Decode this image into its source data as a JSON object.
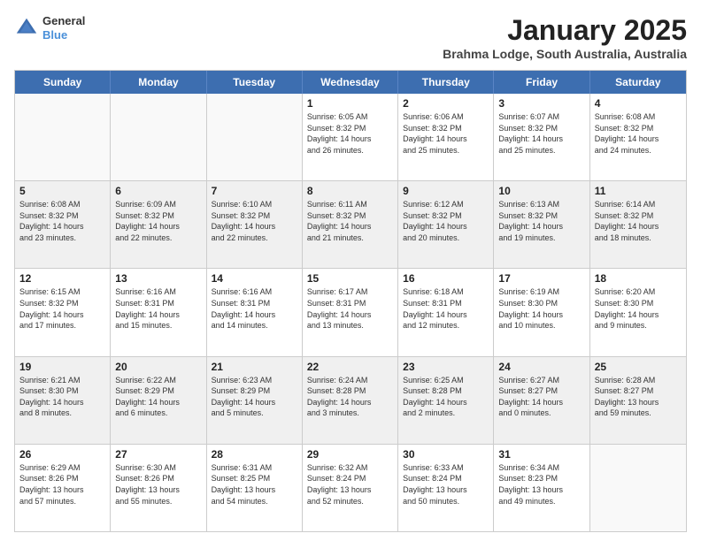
{
  "logo": {
    "line1": "General",
    "line2": "Blue"
  },
  "title": "January 2025",
  "location": "Brahma Lodge, South Australia, Australia",
  "days_of_week": [
    "Sunday",
    "Monday",
    "Tuesday",
    "Wednesday",
    "Thursday",
    "Friday",
    "Saturday"
  ],
  "weeks": [
    [
      {
        "day": "",
        "info": "",
        "empty": true
      },
      {
        "day": "",
        "info": "",
        "empty": true
      },
      {
        "day": "",
        "info": "",
        "empty": true
      },
      {
        "day": "1",
        "info": "Sunrise: 6:05 AM\nSunset: 8:32 PM\nDaylight: 14 hours\nand 26 minutes."
      },
      {
        "day": "2",
        "info": "Sunrise: 6:06 AM\nSunset: 8:32 PM\nDaylight: 14 hours\nand 25 minutes."
      },
      {
        "day": "3",
        "info": "Sunrise: 6:07 AM\nSunset: 8:32 PM\nDaylight: 14 hours\nand 25 minutes."
      },
      {
        "day": "4",
        "info": "Sunrise: 6:08 AM\nSunset: 8:32 PM\nDaylight: 14 hours\nand 24 minutes."
      }
    ],
    [
      {
        "day": "5",
        "info": "Sunrise: 6:08 AM\nSunset: 8:32 PM\nDaylight: 14 hours\nand 23 minutes."
      },
      {
        "day": "6",
        "info": "Sunrise: 6:09 AM\nSunset: 8:32 PM\nDaylight: 14 hours\nand 22 minutes."
      },
      {
        "day": "7",
        "info": "Sunrise: 6:10 AM\nSunset: 8:32 PM\nDaylight: 14 hours\nand 22 minutes."
      },
      {
        "day": "8",
        "info": "Sunrise: 6:11 AM\nSunset: 8:32 PM\nDaylight: 14 hours\nand 21 minutes."
      },
      {
        "day": "9",
        "info": "Sunrise: 6:12 AM\nSunset: 8:32 PM\nDaylight: 14 hours\nand 20 minutes."
      },
      {
        "day": "10",
        "info": "Sunrise: 6:13 AM\nSunset: 8:32 PM\nDaylight: 14 hours\nand 19 minutes."
      },
      {
        "day": "11",
        "info": "Sunrise: 6:14 AM\nSunset: 8:32 PM\nDaylight: 14 hours\nand 18 minutes."
      }
    ],
    [
      {
        "day": "12",
        "info": "Sunrise: 6:15 AM\nSunset: 8:32 PM\nDaylight: 14 hours\nand 17 minutes."
      },
      {
        "day": "13",
        "info": "Sunrise: 6:16 AM\nSunset: 8:31 PM\nDaylight: 14 hours\nand 15 minutes."
      },
      {
        "day": "14",
        "info": "Sunrise: 6:16 AM\nSunset: 8:31 PM\nDaylight: 14 hours\nand 14 minutes."
      },
      {
        "day": "15",
        "info": "Sunrise: 6:17 AM\nSunset: 8:31 PM\nDaylight: 14 hours\nand 13 minutes."
      },
      {
        "day": "16",
        "info": "Sunrise: 6:18 AM\nSunset: 8:31 PM\nDaylight: 14 hours\nand 12 minutes."
      },
      {
        "day": "17",
        "info": "Sunrise: 6:19 AM\nSunset: 8:30 PM\nDaylight: 14 hours\nand 10 minutes."
      },
      {
        "day": "18",
        "info": "Sunrise: 6:20 AM\nSunset: 8:30 PM\nDaylight: 14 hours\nand 9 minutes."
      }
    ],
    [
      {
        "day": "19",
        "info": "Sunrise: 6:21 AM\nSunset: 8:30 PM\nDaylight: 14 hours\nand 8 minutes."
      },
      {
        "day": "20",
        "info": "Sunrise: 6:22 AM\nSunset: 8:29 PM\nDaylight: 14 hours\nand 6 minutes."
      },
      {
        "day": "21",
        "info": "Sunrise: 6:23 AM\nSunset: 8:29 PM\nDaylight: 14 hours\nand 5 minutes."
      },
      {
        "day": "22",
        "info": "Sunrise: 6:24 AM\nSunset: 8:28 PM\nDaylight: 14 hours\nand 3 minutes."
      },
      {
        "day": "23",
        "info": "Sunrise: 6:25 AM\nSunset: 8:28 PM\nDaylight: 14 hours\nand 2 minutes."
      },
      {
        "day": "24",
        "info": "Sunrise: 6:27 AM\nSunset: 8:27 PM\nDaylight: 14 hours\nand 0 minutes."
      },
      {
        "day": "25",
        "info": "Sunrise: 6:28 AM\nSunset: 8:27 PM\nDaylight: 13 hours\nand 59 minutes."
      }
    ],
    [
      {
        "day": "26",
        "info": "Sunrise: 6:29 AM\nSunset: 8:26 PM\nDaylight: 13 hours\nand 57 minutes."
      },
      {
        "day": "27",
        "info": "Sunrise: 6:30 AM\nSunset: 8:26 PM\nDaylight: 13 hours\nand 55 minutes."
      },
      {
        "day": "28",
        "info": "Sunrise: 6:31 AM\nSunset: 8:25 PM\nDaylight: 13 hours\nand 54 minutes."
      },
      {
        "day": "29",
        "info": "Sunrise: 6:32 AM\nSunset: 8:24 PM\nDaylight: 13 hours\nand 52 minutes."
      },
      {
        "day": "30",
        "info": "Sunrise: 6:33 AM\nSunset: 8:24 PM\nDaylight: 13 hours\nand 50 minutes."
      },
      {
        "day": "31",
        "info": "Sunrise: 6:34 AM\nSunset: 8:23 PM\nDaylight: 13 hours\nand 49 minutes."
      },
      {
        "day": "",
        "info": "",
        "empty": true
      }
    ]
  ]
}
